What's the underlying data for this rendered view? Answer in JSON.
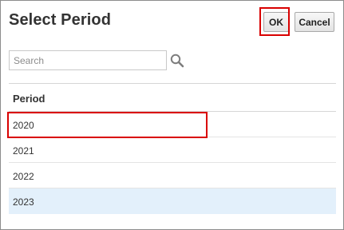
{
  "dialog": {
    "title": "Select Period",
    "ok_label": "OK",
    "cancel_label": "Cancel"
  },
  "search": {
    "placeholder": "Search",
    "value": ""
  },
  "table": {
    "column_header": "Period",
    "rows": [
      "2020",
      "2021",
      "2022",
      "2023"
    ],
    "selected_row": "2023"
  },
  "colors": {
    "highlight_box": "#d90000",
    "selected_row_bg": "#e3f0fb"
  },
  "icons": {
    "search": "magnifier-icon"
  }
}
